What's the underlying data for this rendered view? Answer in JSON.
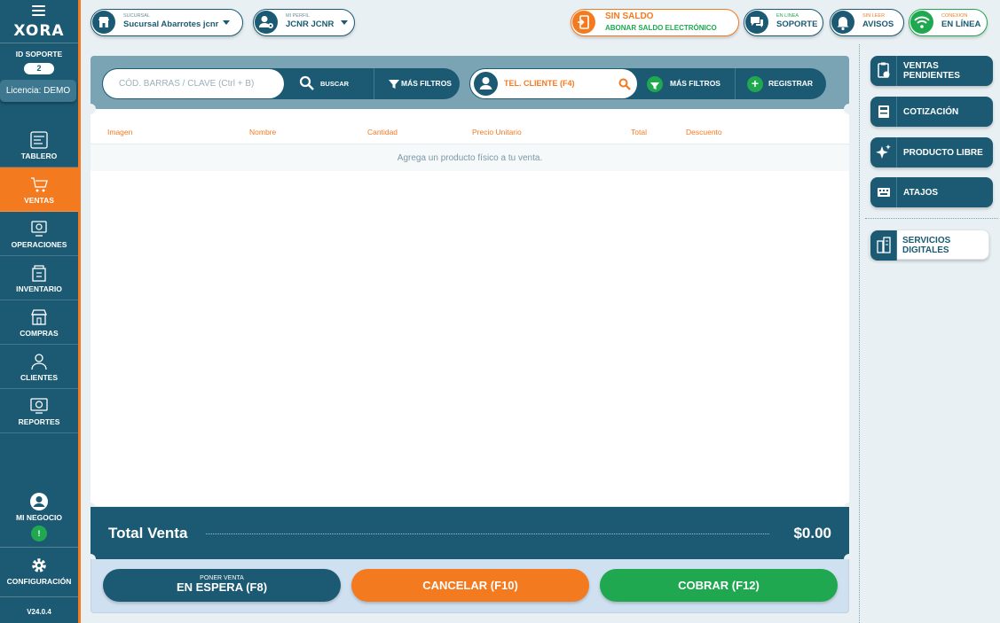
{
  "sidebar": {
    "logo": "XORA",
    "id_label": "ID SOPORTE",
    "id_value": "2",
    "licencia": "Licencia: DEMO",
    "items": [
      {
        "label": "TABLERO",
        "icon": "dashboard-icon"
      },
      {
        "label": "VENTAS",
        "icon": "cart-icon",
        "active": true
      },
      {
        "label": "OPERACIONES",
        "icon": "operations-icon"
      },
      {
        "label": "INVENTARIO",
        "icon": "inventory-icon"
      },
      {
        "label": "COMPRAS",
        "icon": "store-icon"
      },
      {
        "label": "CLIENTES",
        "icon": "client-icon"
      },
      {
        "label": "REPORTES",
        "icon": "report-icon"
      }
    ],
    "mi_negocio": "MI NEGOCIO",
    "mi_negocio_badge": "!",
    "configuracion": "CONFIGURACIÓN",
    "version": "V24.0.4"
  },
  "topbar": {
    "sucursal_small": "SUCURSAL",
    "sucursal_value": "Sucursal Abarrotes jcnr",
    "perfil_small": "MI PERFIL",
    "perfil_value": "JCNR JCNR",
    "saldo_title": "SIN SALDO",
    "saldo_action": "ABONAR SALDO ELECTRÓNICO",
    "soporte_small": "EN LINEA",
    "soporte_value": "SOPORTE",
    "avisos_small": "SIN LEER",
    "avisos_value": "AVISOS",
    "conexion_small": "CONEXION",
    "conexion_value": "EN LÍNEA"
  },
  "search": {
    "placeholder": "CÓD. BARRAS / CLAVE (Ctrl + B)",
    "buscar": "BUSCAR",
    "mas_filtros": "MÁS FILTROS",
    "cliente_placeholder": "TEL. CLIENTE (F4)",
    "mas_filtros_2": "MÁS FILTROS",
    "registrar": "REGISTRAR"
  },
  "table": {
    "columns": [
      "Imagen",
      "Nombre",
      "Cantidad",
      "Precio Unitario",
      "Total",
      "Descuento"
    ],
    "empty_message": "Agrega un producto físico a tu venta."
  },
  "total": {
    "label": "Total Venta",
    "value": "$0.00"
  },
  "actions": {
    "espera_small": "PONER VENTA",
    "espera": "EN ESPERA (F8)",
    "cancelar": "CANCELAR (F10)",
    "cobrar": "COBRAR (F12)"
  },
  "right_panel": {
    "ventas_pendientes": "VENTAS PENDIENTES",
    "cotizacion": "COTIZACIÓN",
    "producto_libre": "PRODUCTO LIBRE",
    "atajos": "ATAJOS",
    "servicios": "SERVICIOS DIGITALES"
  },
  "colors": {
    "primary": "#1b5a72",
    "accent": "#f47a20",
    "success": "#1fa84f"
  }
}
